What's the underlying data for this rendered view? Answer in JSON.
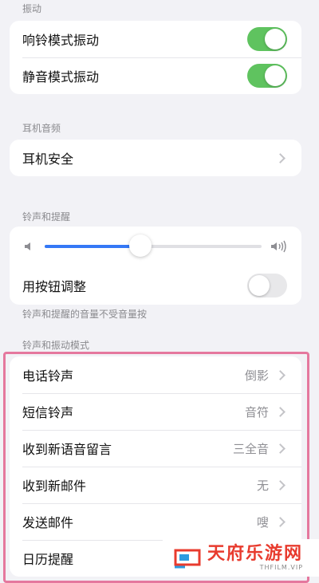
{
  "vibration": {
    "header": "振动",
    "items": [
      {
        "label": "响铃模式振动",
        "on": true
      },
      {
        "label": "静音模式振动",
        "on": true
      }
    ]
  },
  "headphone_audio": {
    "header": "耳机音频",
    "item_label": "耳机安全"
  },
  "ringtone_alerts": {
    "header": "铃声和提醒",
    "volume_level": 0.44,
    "button_adjust_label": "用按钮调整",
    "button_adjust_on": false,
    "footnote": "铃声和提醒的音量不受音量按"
  },
  "sounds_patterns": {
    "header": "铃声和振动模式",
    "items": [
      {
        "label": "电话铃声",
        "value": "倒影"
      },
      {
        "label": "短信铃声",
        "value": "音符"
      },
      {
        "label": "收到新语音留言",
        "value": "三全音"
      },
      {
        "label": "收到新邮件",
        "value": "无"
      },
      {
        "label": "发送邮件",
        "value": "嗖"
      },
      {
        "label": "日历提醒",
        "value": ""
      }
    ]
  },
  "watermark": {
    "main": "天府乐游网",
    "sub": "THFILM.VIP"
  },
  "colors": {
    "toggle_on": "#5fc35f",
    "slider_fill": "#3478f6",
    "highlight_border": "#e5789e",
    "watermark_red": "#e83b2e"
  }
}
